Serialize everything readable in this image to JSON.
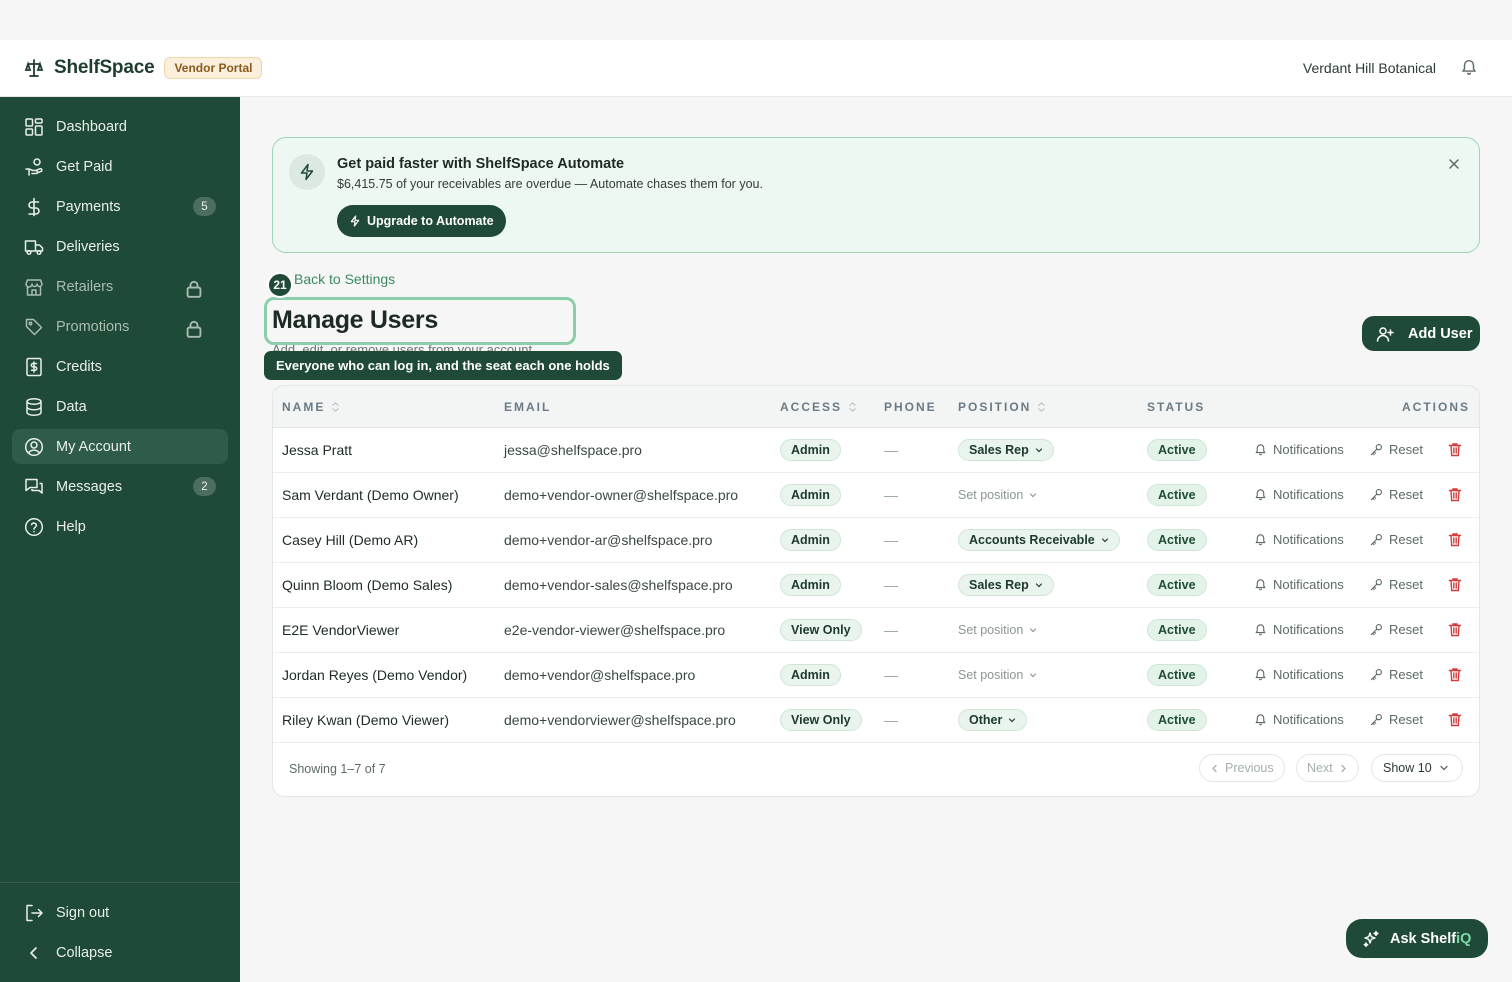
{
  "header": {
    "brand": "ShelfSpace",
    "portal_badge": "Vendor Portal",
    "org_name": "Verdant Hill Botanical"
  },
  "sidebar": {
    "items": [
      {
        "label": "Dashboard",
        "icon": "grid-icon"
      },
      {
        "label": "Get Paid",
        "icon": "hand-coin-icon"
      },
      {
        "label": "Payments",
        "icon": "dollar-icon",
        "count": "5"
      },
      {
        "label": "Deliveries",
        "icon": "truck-icon"
      },
      {
        "label": "Retailers",
        "icon": "store-icon",
        "locked": true
      },
      {
        "label": "Promotions",
        "icon": "tag-icon",
        "locked": true
      },
      {
        "label": "Credits",
        "icon": "receipt-icon"
      },
      {
        "label": "Data",
        "icon": "database-icon"
      },
      {
        "label": "My Account",
        "icon": "user-circle-icon",
        "active": true
      },
      {
        "label": "Messages",
        "icon": "messages-icon",
        "count": "2"
      },
      {
        "label": "Help",
        "icon": "help-circle-icon"
      }
    ],
    "sign_out": "Sign out",
    "collapse": "Collapse"
  },
  "promo": {
    "title": "Get paid faster with ShelfSpace Automate",
    "subtitle": "$6,415.75 of your receivables are overdue — Automate chases them for you.",
    "button": "Upgrade to Automate"
  },
  "page": {
    "back_link": "Back to Settings",
    "step_number": "21",
    "title": "Manage Users",
    "subtitle": "Add, edit, or remove users from your account.",
    "tooltip": "Everyone who can log in, and the seat each one holds",
    "add_user": "Add User"
  },
  "table": {
    "headers": {
      "name": "NAME",
      "email": "EMAIL",
      "access": "ACCESS",
      "phone": "PHONE",
      "position": "POSITION",
      "status": "STATUS",
      "actions": "ACTIONS"
    },
    "notifications_label": "Notifications",
    "reset_label": "Reset",
    "rows": [
      {
        "name": "Jessa Pratt",
        "email": "jessa@shelfspace.pro",
        "access": "Admin",
        "phone": "—",
        "position": "Sales Rep",
        "position_set": true,
        "status": "Active"
      },
      {
        "name": "Sam Verdant (Demo Owner)",
        "email": "demo+vendor-owner@shelfspace.pro",
        "access": "Admin",
        "phone": "—",
        "position": "Set position",
        "position_set": false,
        "status": "Active"
      },
      {
        "name": "Casey Hill (Demo AR)",
        "email": "demo+vendor-ar@shelfspace.pro",
        "access": "Admin",
        "phone": "—",
        "position": "Accounts Receivable",
        "position_set": true,
        "status": "Active"
      },
      {
        "name": "Quinn Bloom (Demo Sales)",
        "email": "demo+vendor-sales@shelfspace.pro",
        "access": "Admin",
        "phone": "—",
        "position": "Sales Rep",
        "position_set": true,
        "status": "Active"
      },
      {
        "name": "E2E VendorViewer",
        "email": "e2e-vendor-viewer@shelfspace.pro",
        "access": "View Only",
        "phone": "—",
        "position": "Set position",
        "position_set": false,
        "status": "Active"
      },
      {
        "name": "Jordan Reyes (Demo Vendor)",
        "email": "demo+vendor@shelfspace.pro",
        "access": "Admin",
        "phone": "—",
        "position": "Set position",
        "position_set": false,
        "status": "Active"
      },
      {
        "name": "Riley Kwan (Demo Viewer)",
        "email": "demo+vendorviewer@shelfspace.pro",
        "access": "View Only",
        "phone": "—",
        "position": "Other",
        "position_set": true,
        "status": "Active"
      }
    ],
    "footer": {
      "showing": "Showing 1–7 of 7",
      "previous": "Previous",
      "next": "Next",
      "page_size": "Show 10"
    }
  },
  "assistant": {
    "label_main": "Ask Shelf",
    "label_accent": "iQ"
  },
  "colors": {
    "sidebar_bg": "#1f4a37",
    "accent_green": "#3c8a61",
    "delete_red": "#d63b3b"
  }
}
